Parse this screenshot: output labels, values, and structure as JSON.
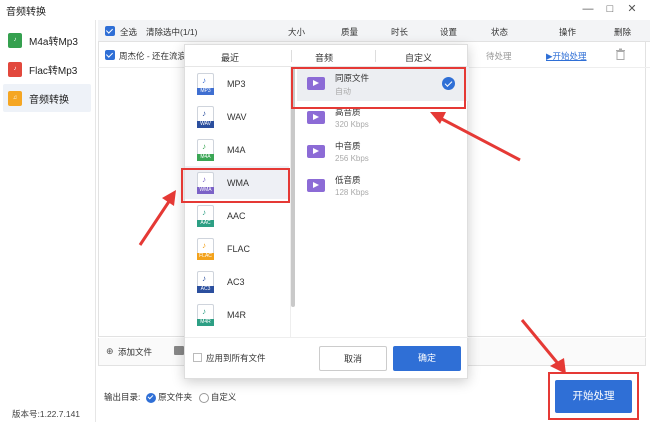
{
  "window": {
    "title": "音频转换",
    "min_label": "—",
    "max_label": "□",
    "close_label": "✕"
  },
  "sidebar": {
    "items": [
      {
        "label": "M4a转Mp3",
        "icon": "m4a-file-icon",
        "active": false
      },
      {
        "label": "Flac转Mp3",
        "icon": "flac-file-icon",
        "active": false
      },
      {
        "label": "音频转换",
        "icon": "music-note-icon",
        "active": true
      }
    ],
    "version": "版本号:1.22.7.141"
  },
  "table": {
    "select_all": "全选",
    "clear_selected": "清除选中(1/1)",
    "columns": [
      "大小",
      "质量",
      "时长",
      "设置",
      "状态",
      "操作",
      "删除"
    ],
    "rows": [
      {
        "name": "周杰伦 - 还在流浪",
        "status": "待处理",
        "action": "▶开始处理"
      }
    ]
  },
  "footer": {
    "add_file": "添加文件",
    "output_label": "输出目录:",
    "option_original": "原文件夹",
    "option_custom": "自定义",
    "start_button": "开始处理"
  },
  "popup": {
    "tabs": [
      "最近",
      "音频",
      "自定义"
    ],
    "formats": [
      {
        "name": "MP3",
        "color": "#3f6fd1",
        "selected": false
      },
      {
        "name": "WAV",
        "color": "#2b4f9e",
        "selected": false
      },
      {
        "name": "M4A",
        "color": "#3aa655",
        "selected": false
      },
      {
        "name": "WMA",
        "color": "#7b62c7",
        "selected": true
      },
      {
        "name": "AAC",
        "color": "#2d9f84",
        "selected": false
      },
      {
        "name": "FLAC",
        "color": "#f3a21b",
        "selected": false
      },
      {
        "name": "AC3",
        "color": "#2b4f9e",
        "selected": false
      },
      {
        "name": "M4R",
        "color": "#2d9f84",
        "selected": false
      }
    ],
    "qualities": [
      {
        "title": "同原文件",
        "sub": "自动",
        "selected": true
      },
      {
        "title": "高音质",
        "sub": "320 Kbps",
        "selected": false
      },
      {
        "title": "中音质",
        "sub": "256 Kbps",
        "selected": false
      },
      {
        "title": "低音质",
        "sub": "128 Kbps",
        "selected": false
      }
    ],
    "apply_all": "应用到所有文件",
    "cancel": "取消",
    "ok": "确定"
  },
  "colors": {
    "accent": "#2f6fd6",
    "highlight": "#e53935"
  }
}
